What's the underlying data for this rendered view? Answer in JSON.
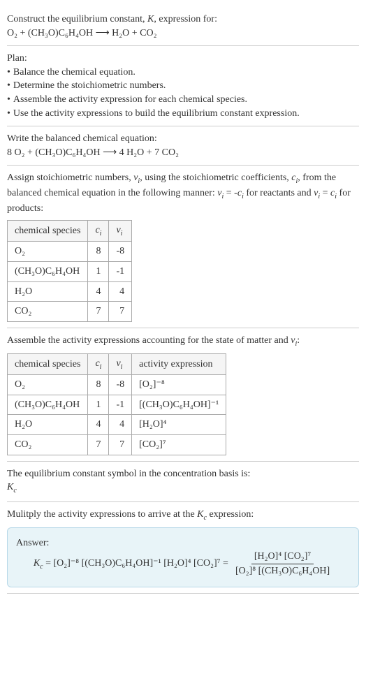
{
  "construct": {
    "line1": "Construct the equilibrium constant, K, expression for:",
    "equation": "O₂ + (CH₃O)C₆H₄OH ⟶ H₂O + CO₂"
  },
  "plan": {
    "title": "Plan:",
    "items": [
      "Balance the chemical equation.",
      "Determine the stoichiometric numbers.",
      "Assemble the activity expression for each chemical species.",
      "Use the activity expressions to build the equilibrium constant expression."
    ]
  },
  "balanced": {
    "intro": "Write the balanced chemical equation:",
    "equation": "8 O₂ + (CH₃O)C₆H₄OH ⟶ 4 H₂O + 7 CO₂"
  },
  "stoich": {
    "intro_part1": "Assign stoichiometric numbers, νᵢ, using the stoichiometric coefficients, cᵢ, from the balanced chemical equation in the following manner: νᵢ = -cᵢ for reactants and νᵢ = cᵢ for products:",
    "headers": [
      "chemical species",
      "cᵢ",
      "νᵢ"
    ],
    "rows": [
      {
        "species": "O₂",
        "c": "8",
        "v": "-8"
      },
      {
        "species": "(CH₃O)C₆H₄OH",
        "c": "1",
        "v": "-1"
      },
      {
        "species": "H₂O",
        "c": "4",
        "v": "4"
      },
      {
        "species": "CO₂",
        "c": "7",
        "v": "7"
      }
    ]
  },
  "activity": {
    "intro": "Assemble the activity expressions accounting for the state of matter and νᵢ:",
    "headers": [
      "chemical species",
      "cᵢ",
      "νᵢ",
      "activity expression"
    ],
    "rows": [
      {
        "species": "O₂",
        "c": "8",
        "v": "-8",
        "expr": "[O₂]⁻⁸"
      },
      {
        "species": "(CH₃O)C₆H₄OH",
        "c": "1",
        "v": "-1",
        "expr": "[(CH₃O)C₆H₄OH]⁻¹"
      },
      {
        "species": "H₂O",
        "c": "4",
        "v": "4",
        "expr": "[H₂O]⁴"
      },
      {
        "species": "CO₂",
        "c": "7",
        "v": "7",
        "expr": "[CO₂]⁷"
      }
    ]
  },
  "symbol": {
    "line1": "The equilibrium constant symbol in the concentration basis is:",
    "line2": "K𝒸"
  },
  "multiply": {
    "intro": "Mulitply the activity expressions to arrive at the K𝒸 expression:"
  },
  "answer": {
    "label": "Answer:",
    "lhs": "K𝒸 = [O₂]⁻⁸ [(CH₃O)C₆H₄OH]⁻¹ [H₂O]⁴ [CO₂]⁷ =",
    "num": "[H₂O]⁴ [CO₂]⁷",
    "den": "[O₂]⁸ [(CH₃O)C₆H₄OH]"
  },
  "chart_data": {
    "type": "table",
    "tables": [
      {
        "title": "Stoichiometric numbers",
        "columns": [
          "chemical species",
          "c_i",
          "v_i"
        ],
        "rows": [
          [
            "O2",
            8,
            -8
          ],
          [
            "(CH3O)C6H4OH",
            1,
            -1
          ],
          [
            "H2O",
            4,
            4
          ],
          [
            "CO2",
            7,
            7
          ]
        ]
      },
      {
        "title": "Activity expressions",
        "columns": [
          "chemical species",
          "c_i",
          "v_i",
          "activity expression"
        ],
        "rows": [
          [
            "O2",
            8,
            -8,
            "[O2]^-8"
          ],
          [
            "(CH3O)C6H4OH",
            1,
            -1,
            "[(CH3O)C6H4OH]^-1"
          ],
          [
            "H2O",
            4,
            4,
            "[H2O]^4"
          ],
          [
            "CO2",
            7,
            7,
            "[CO2]^7"
          ]
        ]
      }
    ]
  }
}
